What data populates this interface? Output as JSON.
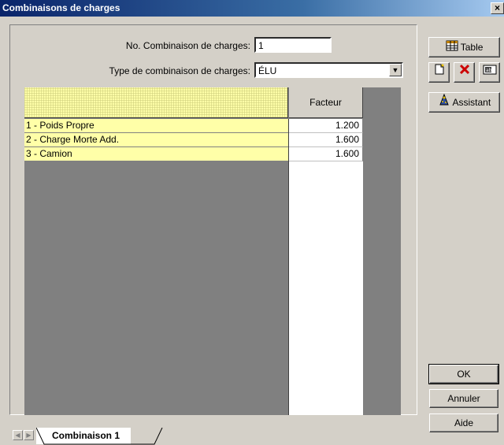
{
  "window": {
    "title": "Combinaisons de charges",
    "close_glyph": "×"
  },
  "form": {
    "number_label": "No. Combinaison de charges:",
    "number_value": "1",
    "type_label": "Type de combinaison de charges:",
    "type_value": "ÉLU"
  },
  "table": {
    "factor_header": "Facteur",
    "rows": [
      {
        "name": "1 - Poids Propre",
        "factor": "1.200"
      },
      {
        "name": "2 - Charge Morte Add.",
        "factor": "1.600"
      },
      {
        "name": "3 - Camion",
        "factor": "1.600"
      }
    ]
  },
  "side": {
    "table_label": "Table",
    "assistant_label": "Assistant",
    "ok_label": "OK",
    "cancel_label": "Annuler",
    "help_label": "Aide"
  },
  "tabs": [
    {
      "label": "Combinaison 1"
    }
  ],
  "colors": {
    "header_yellow": "#ffffa8",
    "title_blue": "#0a246a",
    "delete_red": "#cc0000"
  }
}
